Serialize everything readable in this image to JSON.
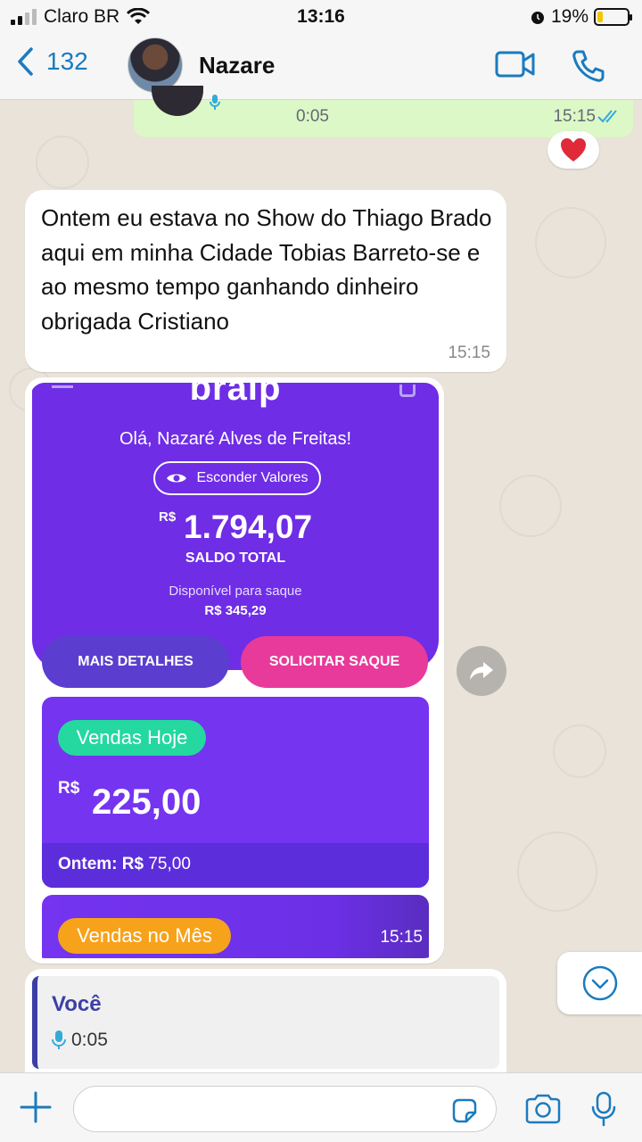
{
  "status_bar": {
    "carrier": "Claro BR",
    "time": "13:16",
    "battery": "19%",
    "battery_level": 0.19
  },
  "header": {
    "back_count": "132",
    "contact_name": "Nazare"
  },
  "messages": {
    "outgoing_audio": {
      "duration": "0:05",
      "time": "15:15"
    },
    "reaction": "heart",
    "incoming_text": {
      "text": "Ontem eu estava no Show do Thiago Brado aqui em minha Cidade Tobias Barreto-se e ao mesmo tempo ganhando dinheiro obrigada Cristiano",
      "time": "15:15"
    },
    "image": {
      "time": "15:15",
      "app": {
        "logo": "braip",
        "greeting": "Olá, Nazaré Alves de Freitas!",
        "hide_button": "Esconder Valores",
        "currency": "R$",
        "balance": "1.794,07",
        "balance_label": "SALDO TOTAL",
        "available_label": "Disponível para saque",
        "available_value": "R$ 345,29",
        "details_button": "MAIS DETALHES",
        "withdraw_button": "SOLICITAR SAQUE",
        "sales_today_label": "Vendas Hoje",
        "sales_today_currency": "R$",
        "sales_today_value": "225,00",
        "yesterday_label": "Ontem: R$",
        "yesterday_value": "75,00",
        "sales_month_label": "Vendas no Mês"
      }
    },
    "quoted_reply": {
      "author": "Você",
      "duration": "0:05"
    }
  },
  "composer": {
    "placeholder": ""
  },
  "colors": {
    "accent": "#1b7bbf",
    "outgoing_bubble": "#dcf8c6",
    "app_purple": "#6f2de6",
    "pink": "#e83a9a",
    "green": "#24d8a0",
    "orange": "#f7a21b"
  },
  "icons": [
    "chevron-left-icon",
    "video-call-icon",
    "phone-icon",
    "heart-icon",
    "forward-icon",
    "chevron-down-icon",
    "plus-icon",
    "sticker-icon",
    "camera-icon",
    "microphone-icon",
    "eye-icon",
    "double-check-icon"
  ]
}
